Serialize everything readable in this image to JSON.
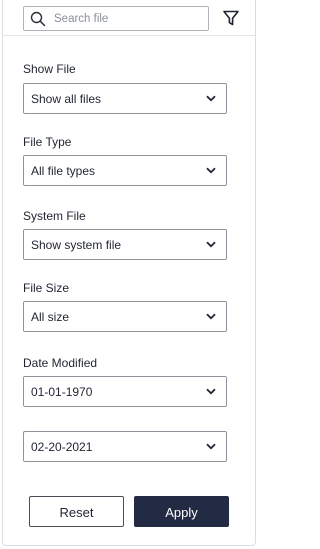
{
  "search": {
    "placeholder": "Search file",
    "value": ""
  },
  "icons": {
    "search": "search-icon",
    "filter": "filter-icon",
    "chevron": "chevron-down-icon"
  },
  "filters": {
    "show_file": {
      "label": "Show File",
      "value": "Show all files"
    },
    "file_type": {
      "label": "File Type",
      "value": "All file types"
    },
    "system_file": {
      "label": "System File",
      "value": "Show system file"
    },
    "file_size": {
      "label": "File Size",
      "value": "All size"
    },
    "date_modified": {
      "label": "Date Modified",
      "from": "01-01-1970",
      "to": "02-20-2021"
    }
  },
  "actions": {
    "reset": "Reset",
    "apply": "Apply"
  },
  "colors": {
    "apply_bg": "#232a44",
    "border": "#8f949c"
  }
}
